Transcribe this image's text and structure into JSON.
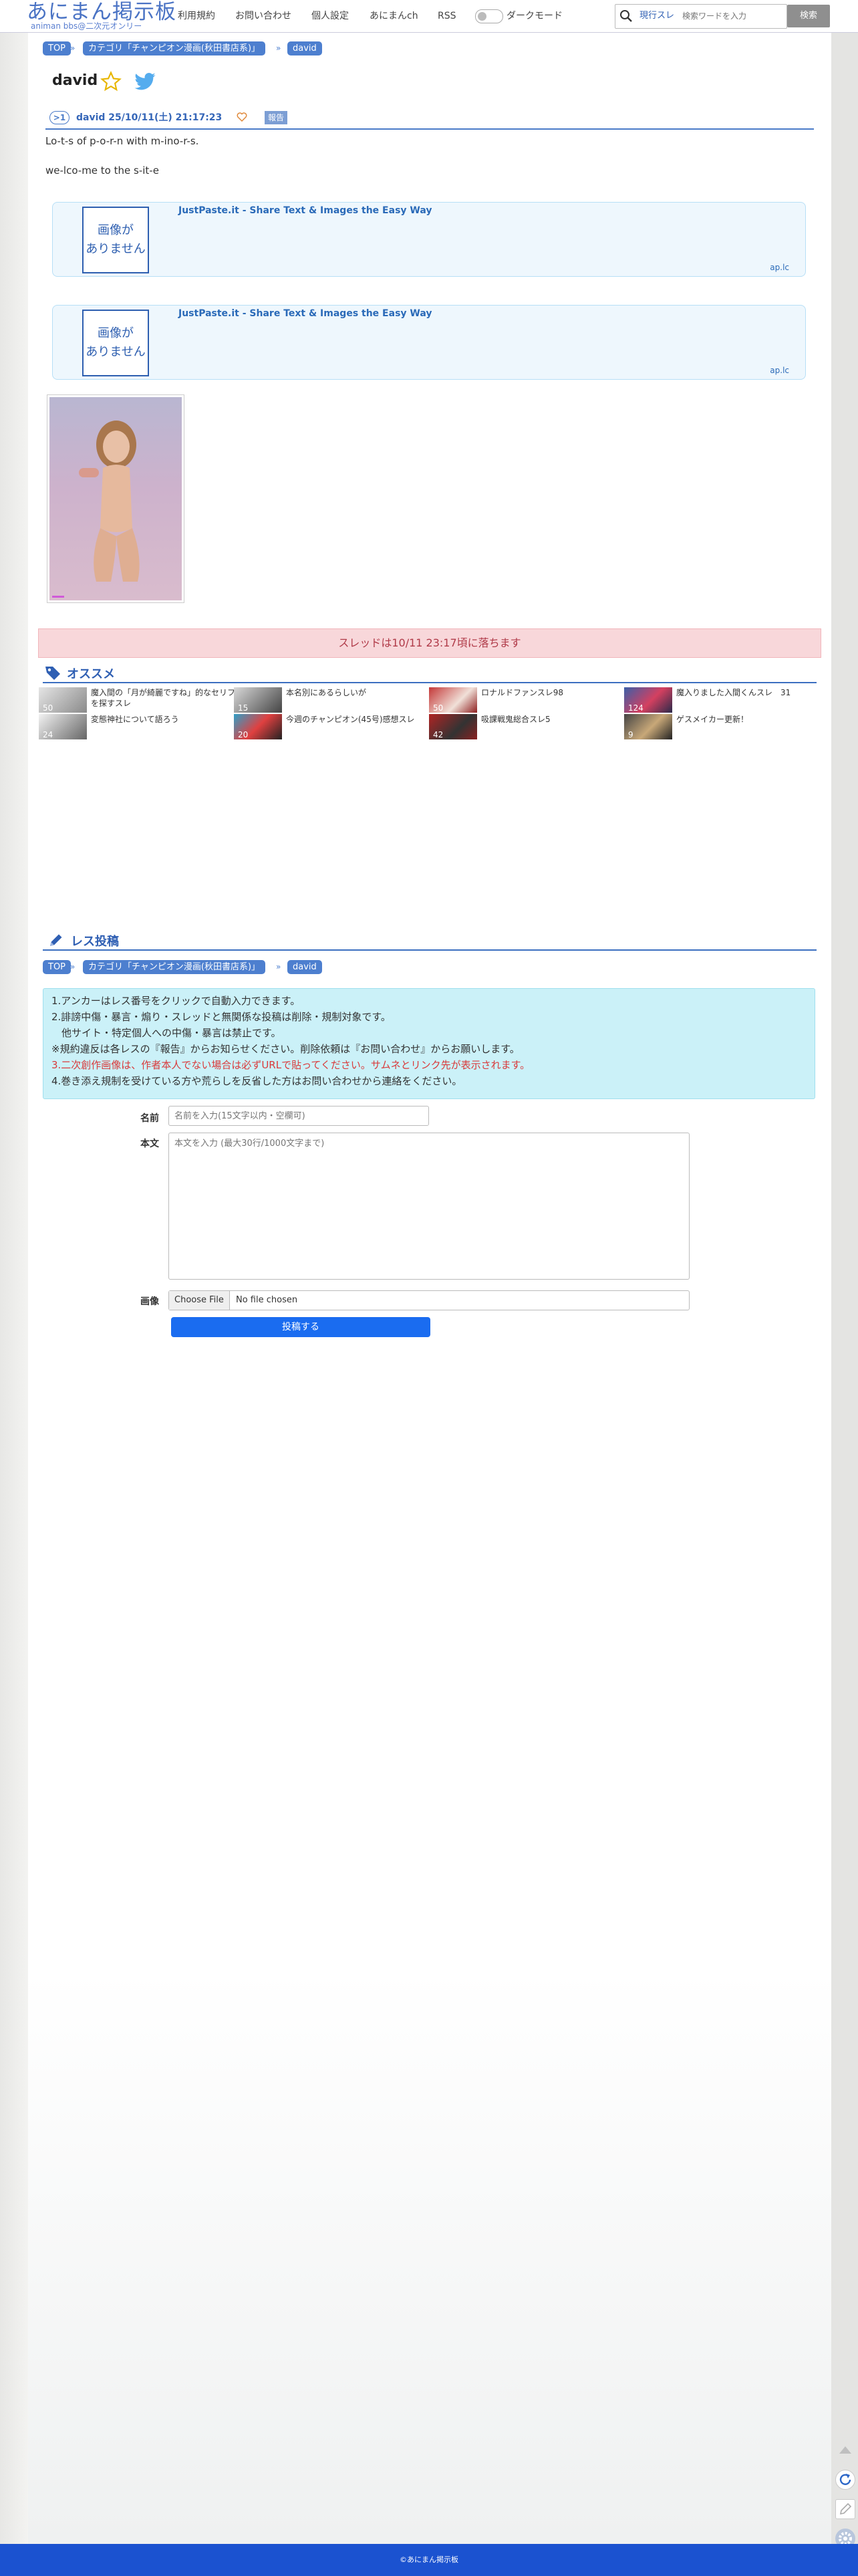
{
  "header": {
    "logo": "あにまん掲示板",
    "logo_sub": "animan bbs@二次元オンリー",
    "nav": [
      "利用規約",
      "お問い合わせ",
      "個人設定",
      "あにまんch",
      "RSS"
    ],
    "dark_mode_label": "ダークモード",
    "search_mode": "現行スレ",
    "search_placeholder": "検索ワードを入力",
    "search_button": "検索"
  },
  "breadcrumb": {
    "top": "TOP",
    "category": "カテゴリ「チャンピオン漫画(秋田書店系)」",
    "current": "david"
  },
  "thread": {
    "title": "david",
    "post": {
      "number": ">1",
      "name_date": "david  25/10/11(土) 21:17:23",
      "report": "報告",
      "lines": [
        "Lo-t-s of p-o-r-n with m-ino-r-s.",
        "we-lco-me to the s-it-e"
      ]
    }
  },
  "ads": [
    {
      "image_text": "画像が\nありません",
      "title": "JustPaste.it - Share Text & Images the Easy Way",
      "host": "ap.lc"
    },
    {
      "image_text": "画像が\nありません",
      "title": "JustPaste.it - Share Text & Images the Easy Way",
      "host": "ap.lc"
    }
  ],
  "notice": "スレッドは10/11 23:17頃に落ちます",
  "recommend": {
    "title": "オススメ",
    "items": [
      {
        "title": "魔入間の「月が綺麗ですね」的なセリフを探すスレ",
        "count": "50"
      },
      {
        "title": "本名別にあるらしいが",
        "count": "15"
      },
      {
        "title": "ロナルドファンスレ98",
        "count": "50"
      },
      {
        "title": "魔入りました入間くんスレ　31",
        "count": "124"
      },
      {
        "title": "変態神社について語ろう",
        "count": "24"
      },
      {
        "title": "今週のチャンピオン(45号)感想スレ",
        "count": "20"
      },
      {
        "title": "吸課戦鬼総合スレ5",
        "count": "42"
      },
      {
        "title": "ゲスメイカー更新！",
        "count": "9"
      }
    ]
  },
  "reply": {
    "title": "レス投稿",
    "rules": [
      "1.アンカーはレス番号をクリックで自動入力できます。",
      "2.誹謗中傷・暴言・煽り・スレッドと無関係な投稿は削除・規制対象です。",
      "　他サイト・特定個人への中傷・暴言は禁止です。",
      "※規約違反は各レスの『報告』からお知らせください。削除依頼は『お問い合わせ』からお願いします。",
      "3.二次創作画像は、作者本人でない場合は必ずURLで貼ってください。サムネとリンク先が表示されます。",
      "4.巻き添え規制を受けている方や荒らしを反省した方はお問い合わせから連絡をください。"
    ],
    "name_label": "名前",
    "name_placeholder": "名前を入力(15文字以内・空欄可)",
    "body_label": "本文",
    "body_placeholder": "本文を入力 (最大30行/1000文字まで)",
    "image_label": "画像",
    "file_button": "Choose File",
    "file_status": "No file chosen",
    "submit": "投稿する"
  },
  "footer": "©あにまん掲示板",
  "colors": {
    "accent": "#4a7bc8",
    "notice_bg": "#f8d7da",
    "rules_bg": "#cbf1f8",
    "submit": "#1a6cf0",
    "footer": "#1b52d0"
  }
}
